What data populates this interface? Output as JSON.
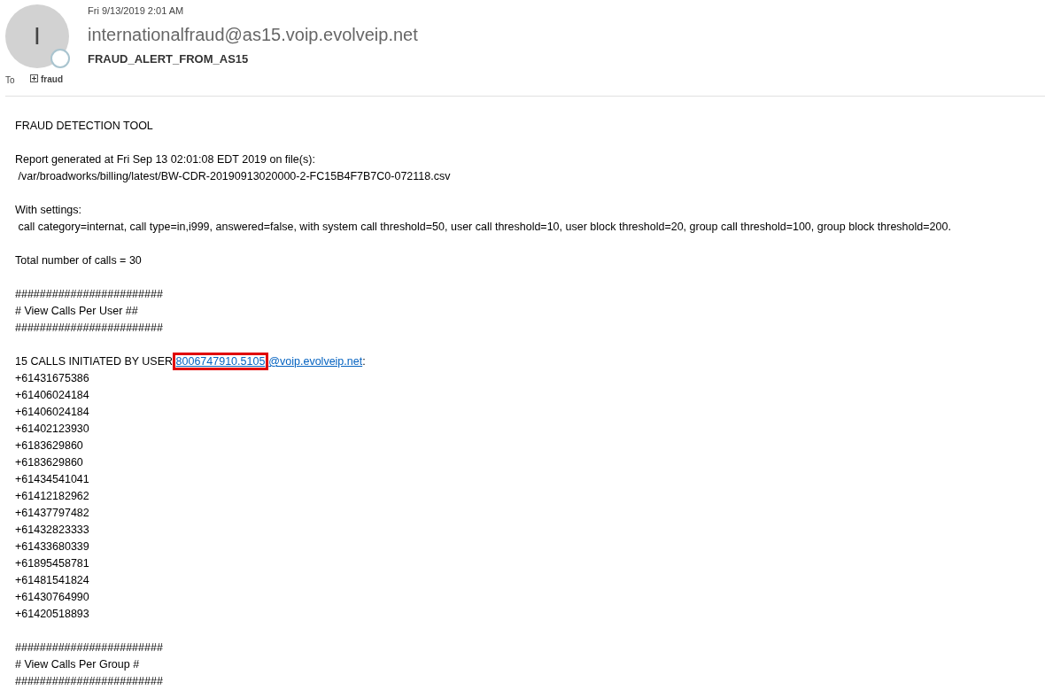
{
  "header": {
    "avatar_initial": "I",
    "date": "Fri 9/13/2019 2:01 AM",
    "sender": "internationalfraud@as15.voip.evolveip.net",
    "subject": "FRAUD_ALERT_FROM_AS15",
    "to_label": "To",
    "recipient": "fraud"
  },
  "body": [
    {
      "kind": "lines",
      "lines": [
        "FRAUD DETECTION TOOL"
      ]
    },
    {
      "kind": "lines",
      "lines": [
        "Report generated at Fri Sep 13 02:01:08 EDT 2019 on file(s):",
        " /var/broadworks/billing/latest/BW-CDR-20190913020000-2-FC15B4F7B7C0-072118.csv"
      ]
    },
    {
      "kind": "lines",
      "lines": [
        "With settings:",
        " call category=internat, call type=in,i999, answered=false, with system call threshold=50, user call threshold=10, user block threshold=20, group call threshold=100, group block threshold=200."
      ]
    },
    {
      "kind": "lines",
      "lines": [
        "Total number of calls = 30"
      ]
    },
    {
      "kind": "lines",
      "lines": [
        "########################",
        "# View Calls Per User ##",
        "########################"
      ]
    },
    {
      "kind": "user_calls",
      "prefix": "15 CALLS INITIATED BY USER ",
      "user": "8006747910.5105",
      "domain": "@voip.evolveip.net",
      "suffix": ":",
      "highlighted": true,
      "numbers": [
        "+61431675386",
        "+61406024184",
        "+61406024184",
        "+61402123930",
        "+6183629860",
        "+6183629860",
        "+61434541041",
        "+61412182962",
        "+61437797482",
        "+61432823333",
        "+61433680339",
        "+61895458781",
        "+61481541824",
        "+61430764990",
        "+61420518893"
      ]
    },
    {
      "kind": "lines",
      "lines": [
        "########################",
        "# View Calls Per Group #",
        "########################"
      ]
    }
  ]
}
